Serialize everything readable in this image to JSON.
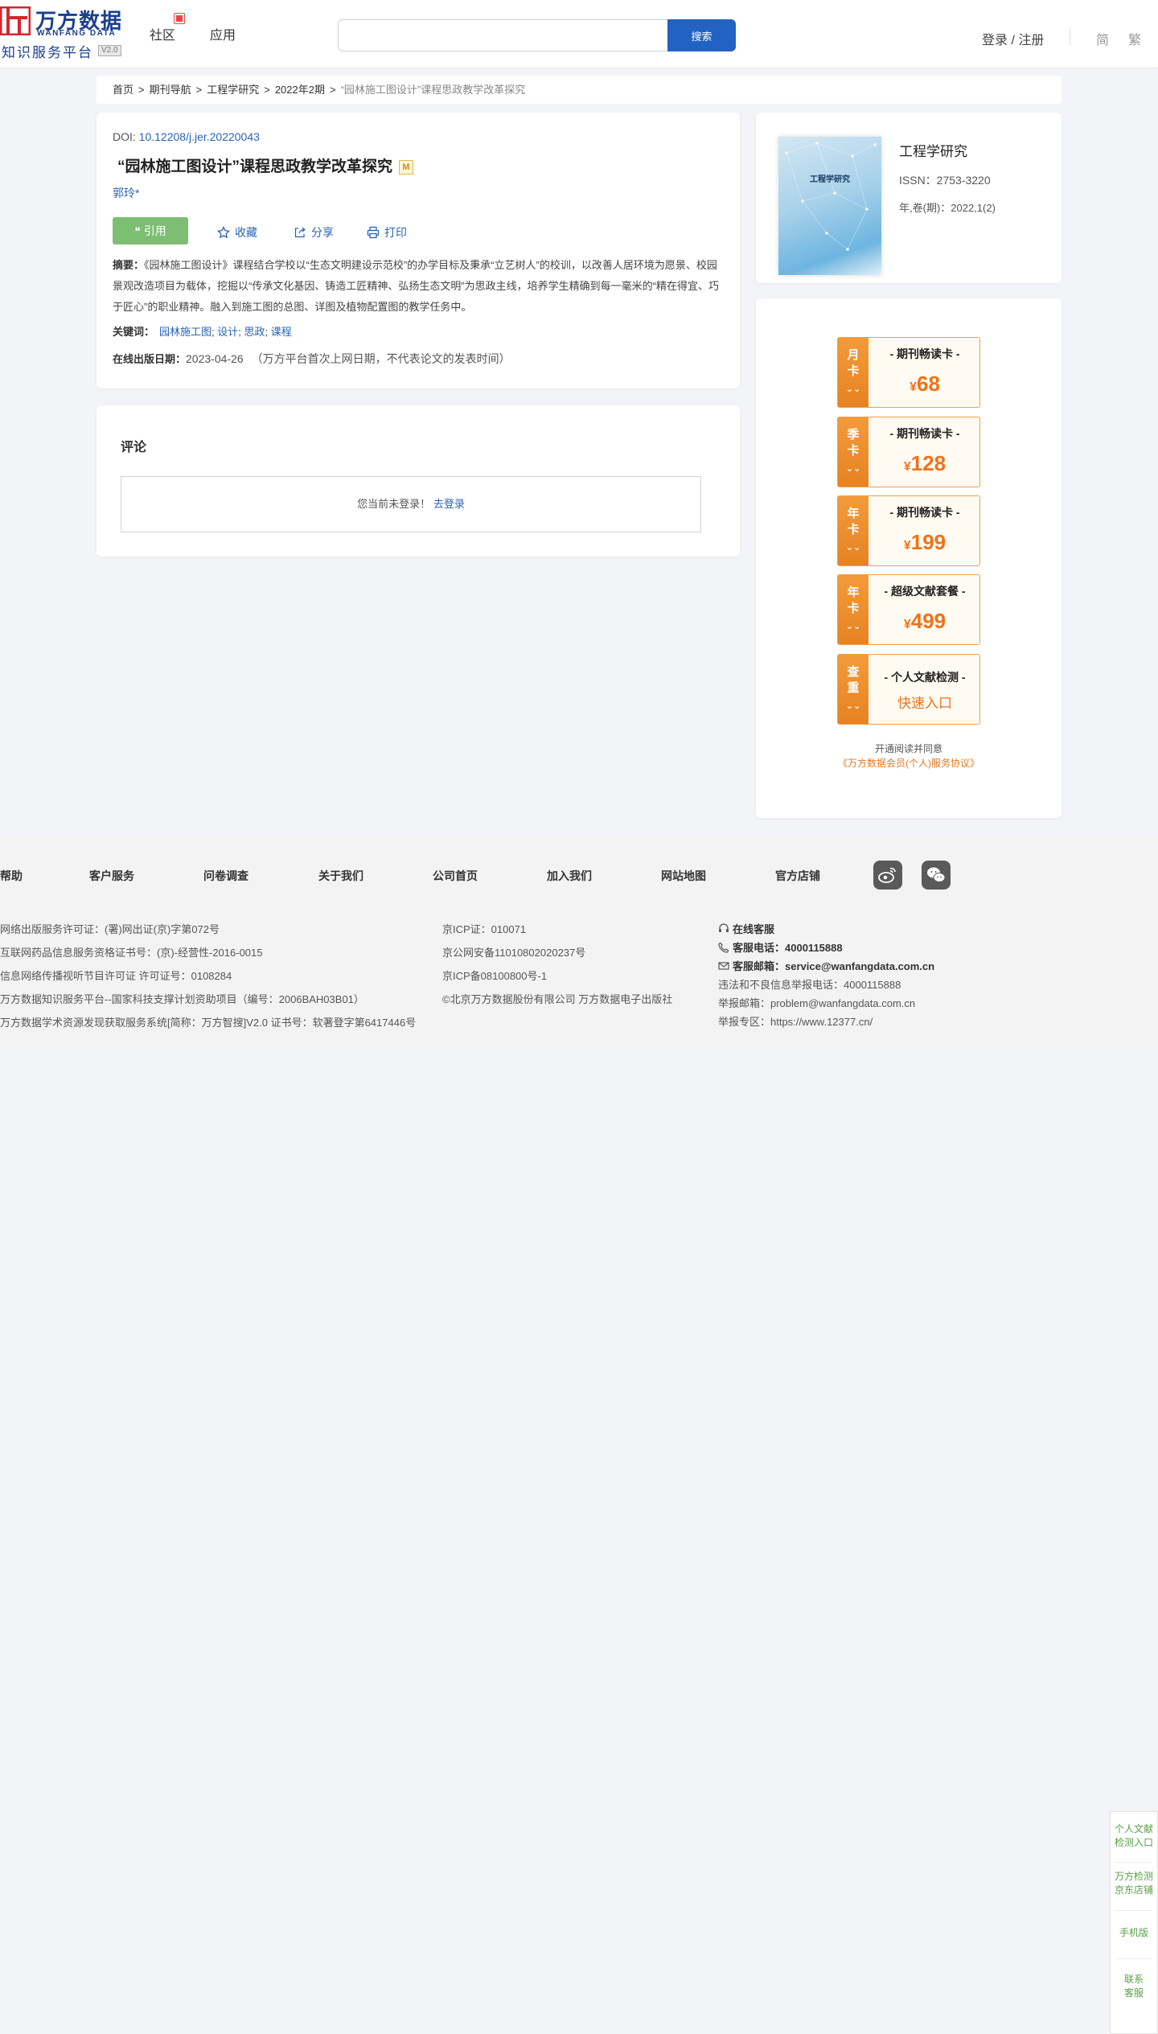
{
  "header": {
    "logo": {
      "cn": "万方数据",
      "en": "WANFANG DATA",
      "subtitle": "知识服务平台",
      "version": "V2.0"
    },
    "nav": {
      "community": "社区",
      "apps": "应用"
    },
    "search": {
      "placeholder": "",
      "button": "搜索"
    },
    "login": "登录 / 注册",
    "lang": {
      "simplified": "简",
      "traditional": "繁"
    }
  },
  "breadcrumb": [
    "首页",
    "期刊导航",
    "工程学研究",
    "2022年2期",
    "“园林施工图设计”课程思政教学改革探究"
  ],
  "article": {
    "doi_label": "DOI: ",
    "doi": "10.12208/j.jer.20220043",
    "title": "“园林施工图设计”课程思政教学改革探究",
    "m_tag": "M",
    "author": "郭玲*",
    "actions": {
      "cite": "引用",
      "favorite": "收藏",
      "share": "分享",
      "print": "打印"
    },
    "abstract_label": "摘要：",
    "abstract": "《园林施工图设计》课程结合学校以“生态文明建设示范校”的办学目标及秉承“立艺树人”的校训，以改善人居环境为愿景、校园景观改造项目为载体，挖掘以“传承文化基因、铸造工匠精神、弘扬生态文明”为思政主线，培养学生精确到每一毫米的“精在得宜、巧于匠心”的职业精神。融入到施工图的总图、详图及植物配置图的教学任务中。",
    "keywords_label": "关键词：",
    "keywords": [
      "园林施工图",
      "设计",
      "思政",
      "课程"
    ],
    "pubdate_label": "在线出版日期：",
    "pubdate": "2023-04-26",
    "pubdate_note": "（万方平台首次上网日期，不代表论文的发表时间）"
  },
  "comments": {
    "title": "评论",
    "not_logged_in": "您当前未登录！",
    "login_link": "去登录"
  },
  "journal": {
    "cover_title": "工程学研究",
    "name": "工程学研究",
    "issn": "ISSN：2753-3220",
    "volume": "年,卷(期)：2022,1(2)"
  },
  "promos": [
    {
      "side": "月卡",
      "name": "- 期刊畅读卡 -",
      "currency": "¥",
      "price": "68"
    },
    {
      "side": "季卡",
      "name": "- 期刊畅读卡 -",
      "currency": "¥",
      "price": "128"
    },
    {
      "side": "年卡",
      "name": "- 期刊畅读卡 -",
      "currency": "¥",
      "price": "199"
    },
    {
      "side": "年卡",
      "name": "- 超级文献套餐 -",
      "currency": "¥",
      "price": "499"
    },
    {
      "side": "查重",
      "name": "- 个人文献检测 -",
      "link": "快速入口"
    }
  ],
  "agreement": {
    "text": "开通阅读并同意",
    "link": "《万方数据会员(个人)服务协议》"
  },
  "footer": {
    "links": [
      "帮助",
      "客户服务",
      "问卷调查",
      "关于我们",
      "公司首页",
      "加入我们",
      "网站地图",
      "官方店铺"
    ],
    "col1": [
      "网络出版服务许可证：(署)网出证(京)字第072号",
      "互联网药品信息服务资格证书号：(京)-经营性-2016-0015",
      "信息网络传播视听节目许可证 许可证号：0108284",
      "万方数据知识服务平台--国家科技支撑计划资助项目（编号：2006BAH03B01）",
      "万方数据学术资源发现获取服务系统[简称：万方智搜]V2.0 证书号：软著登字第6417446号"
    ],
    "col2": [
      "京ICP证：010071",
      "京公网安备11010802020237号",
      "京ICP备08100800号-1",
      "©北京万方数据股份有限公司 万方数据电子出版社"
    ],
    "col3": {
      "online_service": "在线客服",
      "phone_label": "客服电话：",
      "phone": "4000115888",
      "email_label": "客服邮箱：",
      "email": "service@wanfangdata.com.cn",
      "report_phone": "违法和不良信息举报电话：4000115888",
      "report_email": "举报邮箱：problem@wanfangdata.com.cn",
      "report_site": "举报专区：https://www.12377.cn/"
    }
  },
  "side_float": {
    "check": "个人文献检测入口",
    "jd": "万方检测京东店铺",
    "mobile": "手机版",
    "contact": "联系客服"
  },
  "colors": {
    "brand": "#1c3f8f",
    "search_button": "#2162c2",
    "cite_button": "#7cbf73",
    "promo_accent": "#f07219"
  }
}
